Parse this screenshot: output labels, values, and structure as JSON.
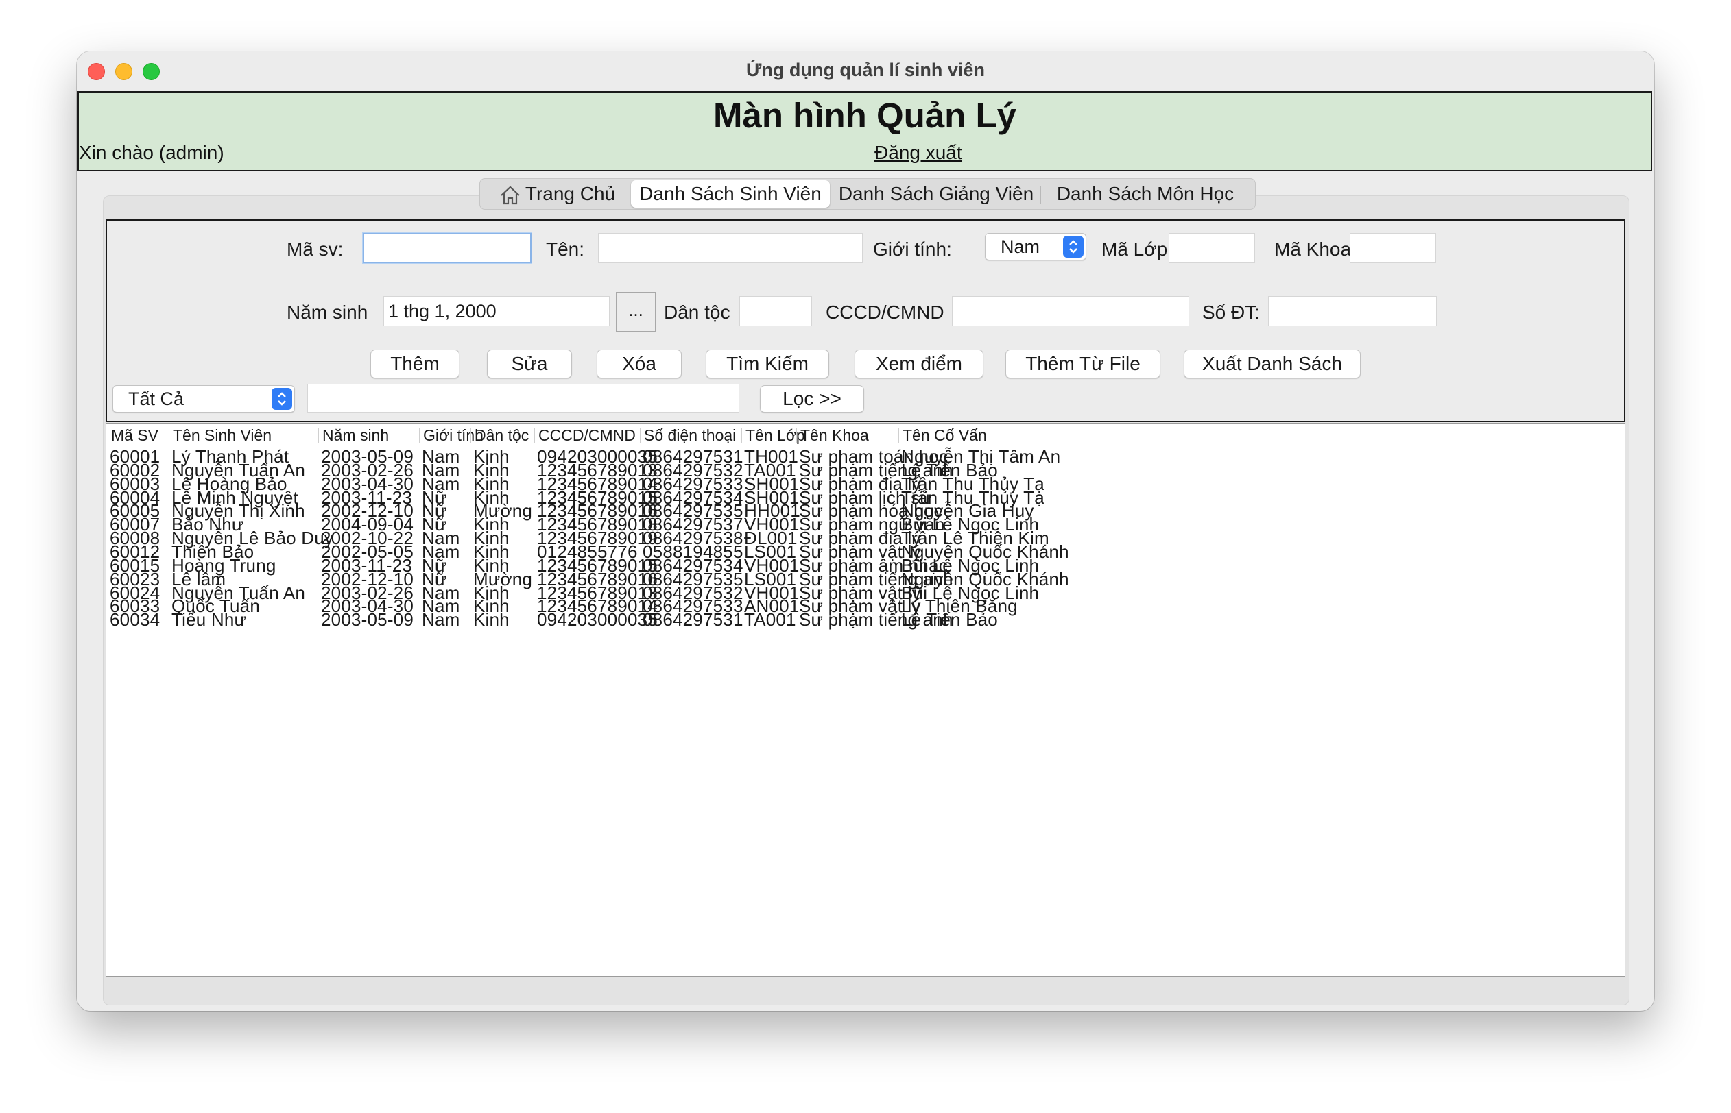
{
  "window": {
    "title": "Ứng dụng quản lí sinh viên"
  },
  "header": {
    "title": "Màn hình Quản Lý",
    "greeting": "Xin chào (admin)",
    "logout": "Đăng xuất"
  },
  "tabs": [
    {
      "label": "Trang Chủ",
      "icon": "home-icon"
    },
    {
      "label": "Danh Sách Sinh Viên",
      "active": true
    },
    {
      "label": "Danh Sách Giảng Viên"
    },
    {
      "label": "Danh Sách Môn Học"
    }
  ],
  "form": {
    "ma_sv_label": "Mã sv:",
    "ma_sv_value": "",
    "ten_label": "Tên:",
    "ten_value": "",
    "gioi_tinh_label": "Giới tính:",
    "gioi_tinh_value": "Nam",
    "ma_lop_label": "Mã Lớp",
    "ma_lop_value": "",
    "ma_khoa_label": "Mã Khoa",
    "ma_khoa_value": "",
    "nam_sinh_label": "Năm sinh",
    "nam_sinh_value": "1 thg 1, 2000",
    "date_picker_label": "...",
    "dan_toc_label": "Dân tộc",
    "dan_toc_value": "",
    "cccd_label": "CCCD/CMND",
    "cccd_value": "",
    "sdt_label": "Số ĐT:",
    "sdt_value": ""
  },
  "actions": {
    "them": "Thêm",
    "sua": "Sửa",
    "xoa": "Xóa",
    "tim_kiem": "Tìm Kiếm",
    "xem_diem": "Xem điểm",
    "them_tu_file": "Thêm Từ File",
    "xuat_danh_sach": "Xuất Danh Sách"
  },
  "filter": {
    "select_value": "Tất Cả",
    "text_value": "",
    "button": "Lọc >>"
  },
  "accent_color": "#2f7cf6",
  "header_bg": "#d6e8d4",
  "table": {
    "columns": [
      "Mã SV",
      "Tên Sinh Viên",
      "Năm sinh",
      "Giới tính",
      "Dân tộc",
      "CCCD/CMND",
      "Số điện thoại",
      "Tên Lớp",
      "Tên Khoa",
      "Tên Cố Vấn"
    ],
    "rows": [
      [
        "60001",
        "Lý Thanh Phát",
        "2003-05-09",
        "Nam",
        "Kinh",
        "094203000035",
        "0864297531",
        "TH001",
        "Sư phạm toán học",
        "Nguyễn Thị Tâm An"
      ],
      [
        "60002",
        "Nguyễn Tuấn An",
        "2003-02-26",
        "Nam",
        "Kinh",
        "123456789013",
        "0864297532",
        "TA001",
        "Sư phạm tiếng anh",
        "Lê Tiến Bảo"
      ],
      [
        "60003",
        "Lê Hoàng Bảo",
        "2003-04-30",
        "Nam",
        "Kinh",
        "123456789014",
        "0864297533",
        "SH001",
        "Sư phạm địa lý",
        "Trần Thu Thủy Tạ"
      ],
      [
        "60004",
        "Lê Minh Nguyệt",
        "2003-11-23",
        "Nữ",
        "Kinh",
        "123456789015",
        "0864297534",
        "SH001",
        "Sư phạm lịch sử",
        "Trần Thu Thủy Tạ"
      ],
      [
        "60005",
        "Nguyễn Thị Xinh",
        "2002-12-10",
        "Nữ",
        "Mường",
        "123456789016",
        "0864297535",
        "HH001",
        "Sư phạm hóa học",
        "Nguyễn Gia Huy"
      ],
      [
        "60007",
        "Bảo Như",
        "2004-09-04",
        "Nữ",
        "Kinh",
        "123456789018",
        "0864297537",
        "VH001",
        "Sư phạm ngữ văn",
        "Bùi Lê Ngọc Linh"
      ],
      [
        "60008",
        "Nguyễn Lê Bảo Duy",
        "2002-10-22",
        "Nam",
        "Kinh",
        "123456789019",
        "0864297538",
        "ĐL001",
        "Sư phạm địa lý",
        "Trần Lê Thiên Kim"
      ],
      [
        "60012",
        "Thiên Bảo",
        "2002-05-05",
        "Nam",
        "Kinh",
        "0124855776",
        "0588194855",
        "LS001",
        "Sư phạm vật lý",
        "Nguyễn Quốc Khánh"
      ],
      [
        "60015",
        "Hoàng Trung",
        "2003-11-23",
        "Nữ",
        "Kinh",
        "123456789015",
        "0864297534",
        "VH001",
        "Sư phạm âm nhạc",
        "Bùi Lê Ngọc Linh"
      ],
      [
        "60023",
        "Lê lâm",
        "2002-12-10",
        "Nữ",
        "Mường",
        "123456789016",
        "0864297535",
        "LS001",
        "Sư phạm tiếng anh",
        "Nguyễn Quốc Khánh"
      ],
      [
        "60024",
        "Nguyễn Tuấn An",
        "2003-02-26",
        "Nam",
        "Kinh",
        "123456789013",
        "0864297532",
        "VH001",
        "Sư phạm vật lý",
        "Bùi Lê Ngọc Linh"
      ],
      [
        "60033",
        "Quốc Tuấn",
        "2003-04-30",
        "Nam",
        "Kinh",
        "123456789014",
        "0864297533",
        "AN001",
        "Sư phạm vật lý",
        "Lý Thiên Băng"
      ],
      [
        "60034",
        "Tiểu Như",
        "2003-05-09",
        "Nam",
        "Kinh",
        "094203000035",
        "0864297531",
        "TA001",
        "Sư phạm tiếng anh",
        "Lê Tiến Bảo"
      ]
    ]
  }
}
